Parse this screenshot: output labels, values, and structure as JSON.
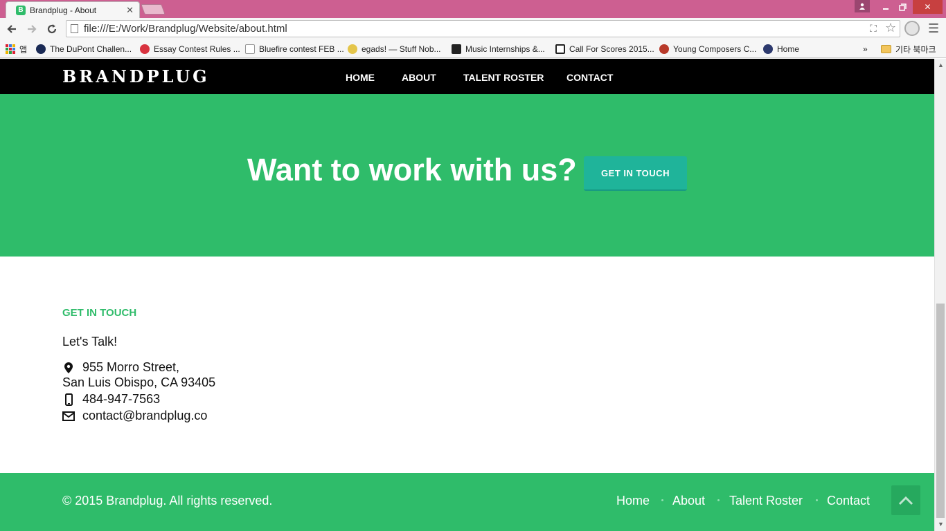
{
  "browser": {
    "tab_title": "Brandplug - About",
    "tab_favicon": "B",
    "url": "file:///E:/Work/Brandplug/Website/about.html",
    "bookmarks": [
      {
        "label": "앱",
        "icon": "apps-icon"
      },
      {
        "label": "The DuPont Challen...",
        "icon": "star-badge-icon"
      },
      {
        "label": "Essay Contest Rules ...",
        "icon": "flower-icon"
      },
      {
        "label": "Bluefire contest FEB ...",
        "icon": "page-icon"
      },
      {
        "label": "egads! — Stuff Nob...",
        "icon": "face-icon"
      },
      {
        "label": "Music Internships &...",
        "icon": "chart-icon"
      },
      {
        "label": "Call For Scores 2015...",
        "icon": "bar-icon"
      },
      {
        "label": "Young Composers C...",
        "icon": "bird-icon"
      },
      {
        "label": "Home",
        "icon": "globe-icon"
      }
    ],
    "bookmarks_overflow": "»",
    "other_bookmarks": "기타 북마크"
  },
  "site": {
    "logo": "BRANDPLUG",
    "nav": [
      "HOME",
      "ABOUT",
      "TALENT ROSTER",
      "CONTACT"
    ],
    "cta": {
      "heading": "Want to work with us?",
      "button": "GET IN TOUCH"
    },
    "contact": {
      "heading": "GET IN TOUCH",
      "subheading": "Let's Talk!",
      "address_line1": "955 Morro Street,",
      "address_line2": "San Luis Obispo, CA 93405",
      "phone": "484-947-7563",
      "email": "contact@brandplug.co"
    },
    "footer": {
      "copyright": "© 2015 Brandplug. All rights reserved.",
      "links": [
        "Home",
        "About",
        "Talent Roster",
        "Contact"
      ]
    }
  },
  "colors": {
    "brand_green": "#2fbc6a",
    "button_teal": "#1fb49a",
    "nav_black": "#000000",
    "titlebar_pink": "#cd5f91"
  }
}
